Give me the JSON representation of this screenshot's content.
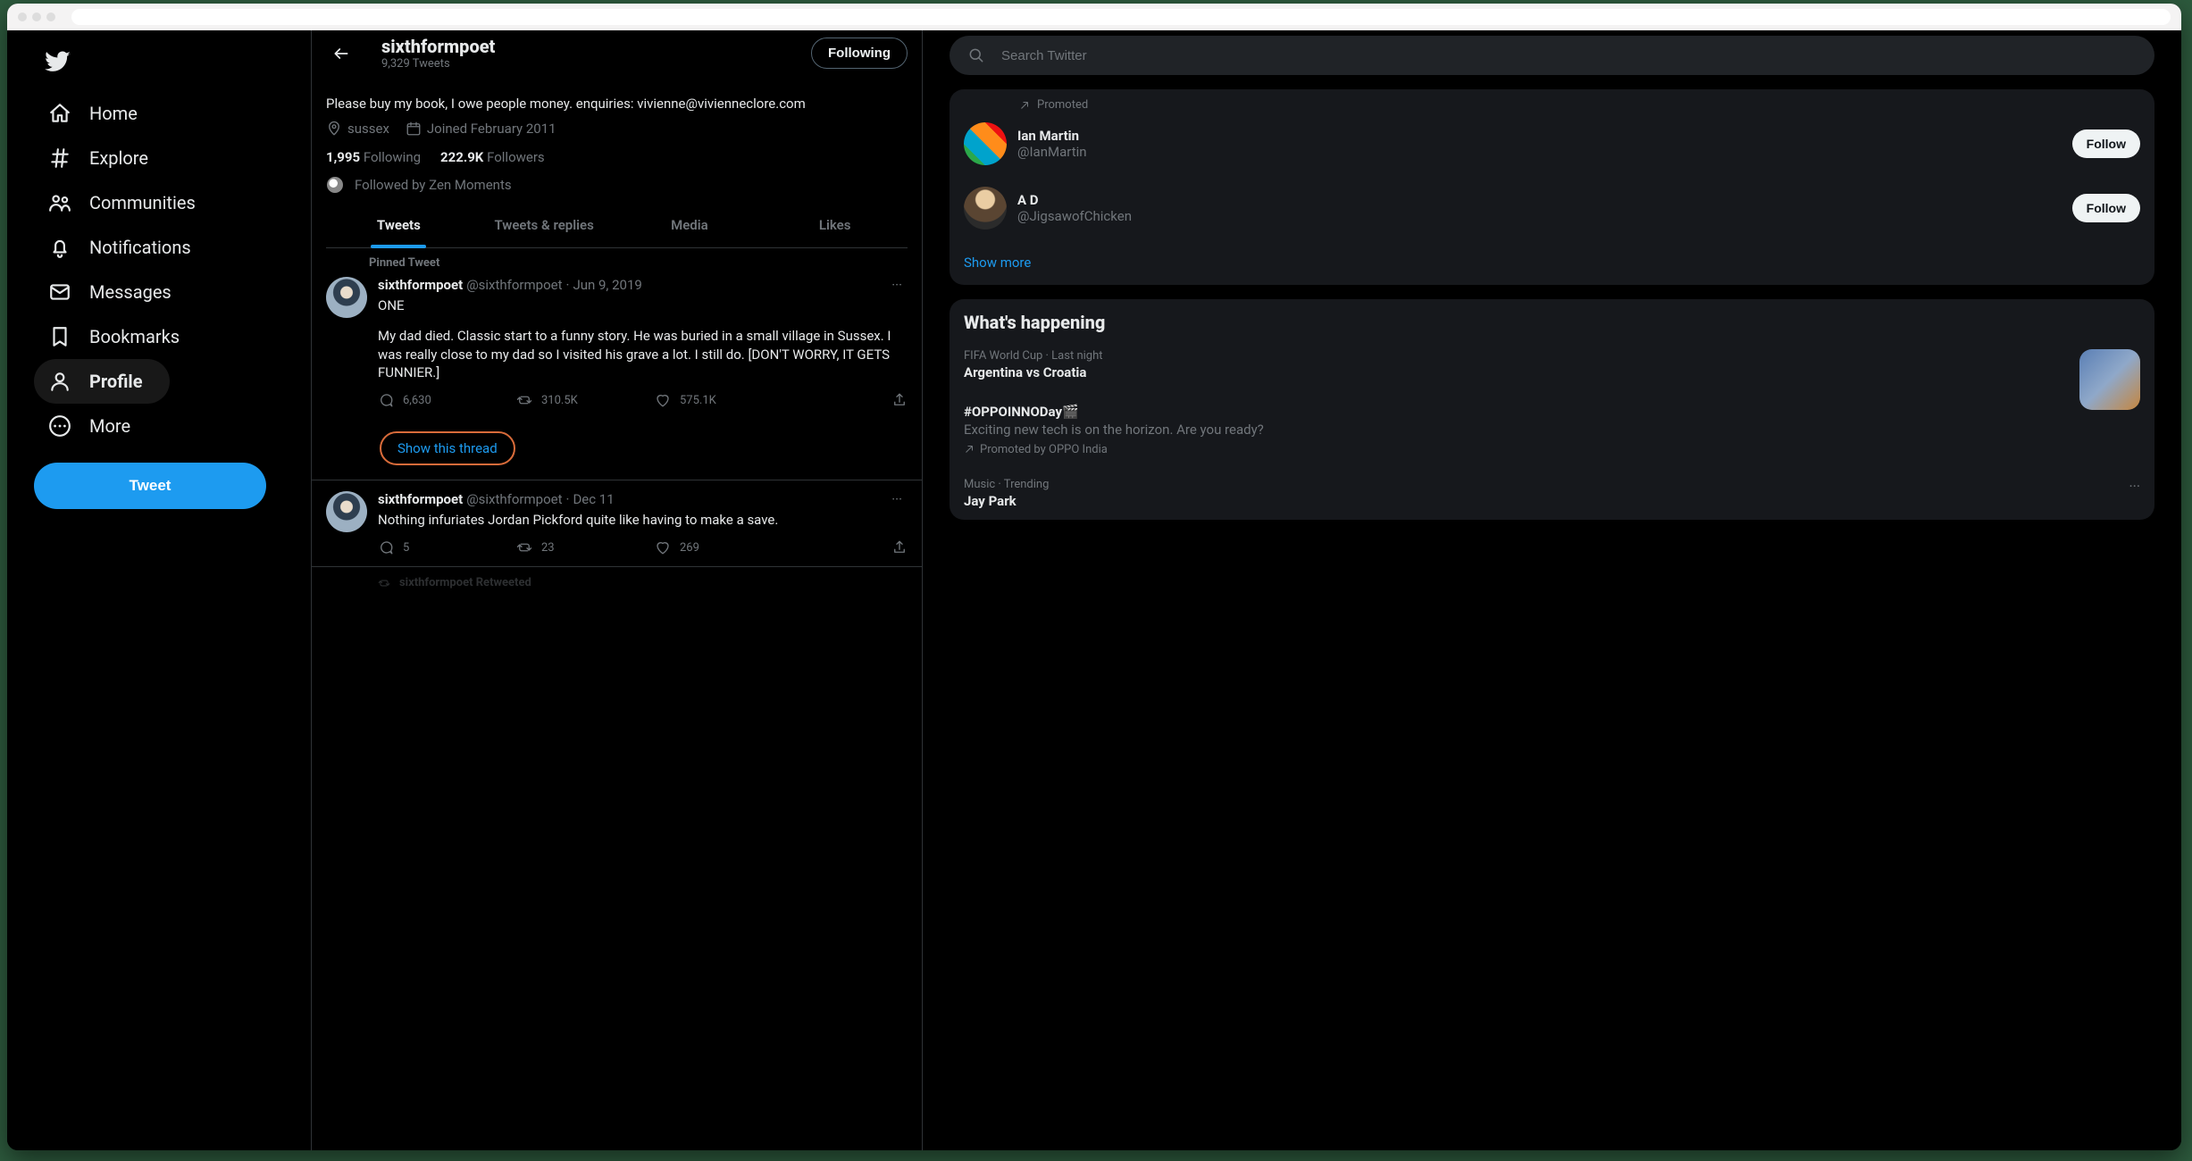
{
  "search": {
    "placeholder": "Search Twitter"
  },
  "nav": {
    "home": "Home",
    "explore": "Explore",
    "communities": "Communities",
    "notifications": "Notifications",
    "messages": "Messages",
    "bookmarks": "Bookmarks",
    "profile": "Profile",
    "more": "More",
    "tweet_btn": "Tweet"
  },
  "header": {
    "name": "sixthformpoet",
    "subtitle": "9,329 Tweets",
    "follow_state": "Following"
  },
  "profile": {
    "bio": "Please buy my book, I owe people money. enquiries: vivienne@vivienneclore.com",
    "location": "sussex",
    "joined": "Joined February 2011",
    "following_count": "1,995",
    "following_label": "Following",
    "followers_count": "222.9K",
    "followers_label": "Followers",
    "followed_by": "Followed by Zen Moments"
  },
  "tabs": {
    "tweets": "Tweets",
    "replies": "Tweets & replies",
    "media": "Media",
    "likes": "Likes"
  },
  "pinned_label": "Pinned Tweet",
  "show_thread": "Show this thread",
  "retweeted_label": "sixthformpoet Retweeted",
  "tweets": [
    {
      "name": "sixthformpoet",
      "handle": "@sixthformpoet",
      "date": "Jun 9, 2019",
      "line1": "ONE",
      "line2": "My dad died. Classic start to a funny story. He was buried in a small village in Sussex. I was really close to my dad so I visited his grave a lot. I still do. [DON'T WORRY, IT GETS FUNNIER.]",
      "replies": "6,630",
      "retweets": "310.5K",
      "likes": "575.1K"
    },
    {
      "name": "sixthformpoet",
      "handle": "@sixthformpoet",
      "date": "Dec 11",
      "line1": "Nothing infuriates Jordan Pickford quite like having to make a save.",
      "replies": "5",
      "retweets": "23",
      "likes": "269"
    }
  ],
  "who_to_follow": {
    "promoted_label": "Promoted",
    "show_more": "Show more",
    "items": [
      {
        "name": "Ian Martin",
        "handle": "@IanMartin"
      },
      {
        "name": "A D",
        "handle": "@JigsawofChicken"
      }
    ],
    "follow_label": "Follow"
  },
  "whats_happening": {
    "title": "What's happening",
    "items": [
      {
        "sub": "FIFA World Cup · Last night",
        "title": "Argentina vs Croatia"
      },
      {
        "title": "#OPPOINNODay🎬",
        "desc": "Exciting new tech is on the horizon. Are you ready?",
        "promoted": "Promoted by OPPO India"
      },
      {
        "sub": "Music · Trending",
        "title": "Jay Park"
      }
    ]
  }
}
